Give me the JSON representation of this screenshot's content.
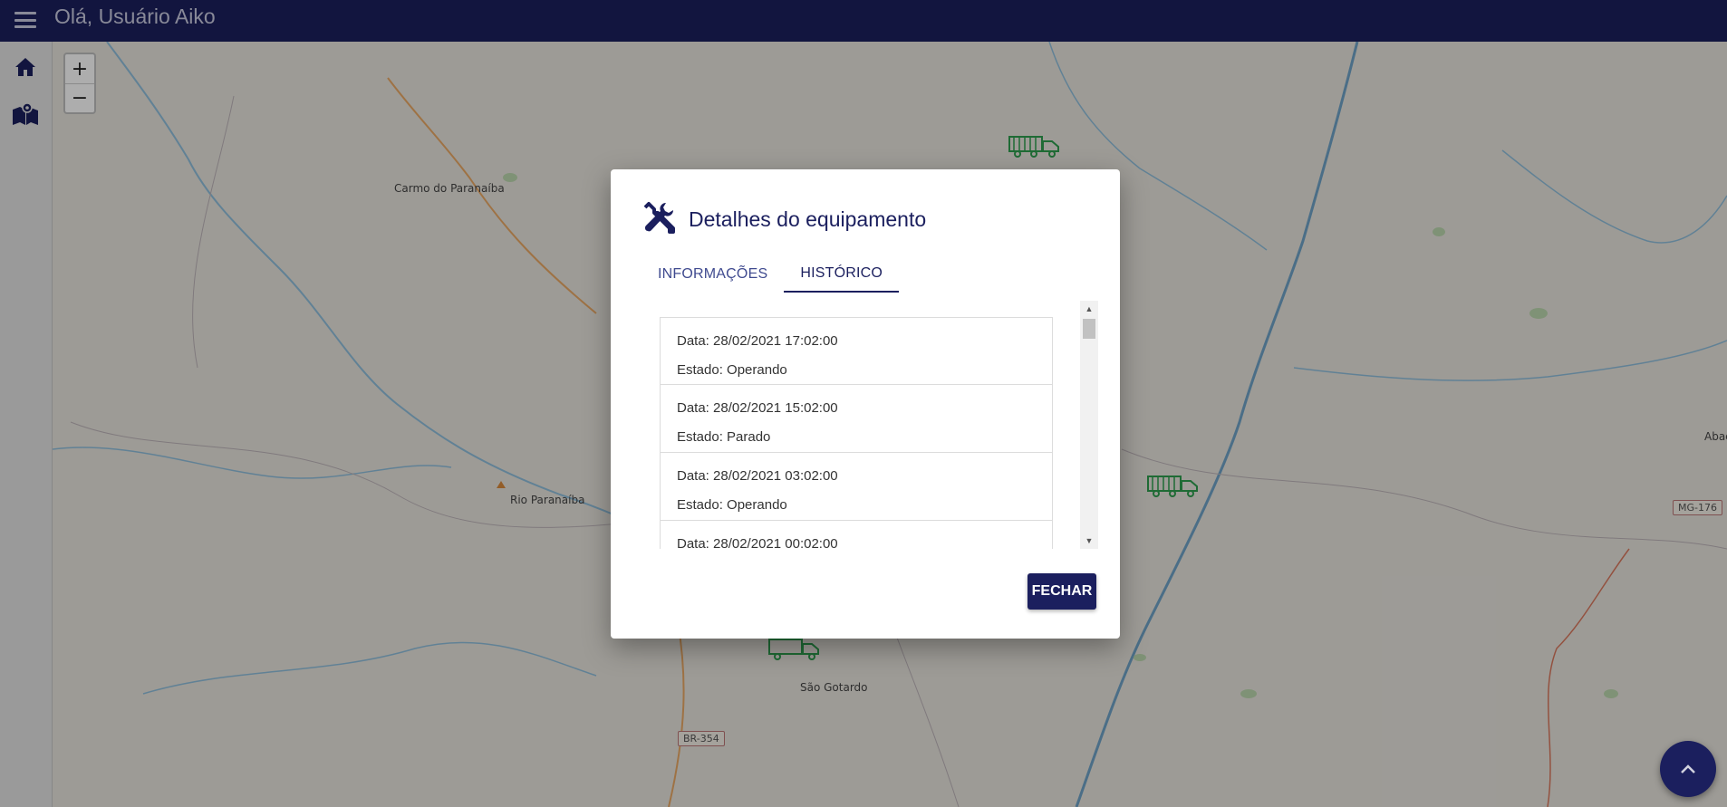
{
  "header": {
    "greeting": "Olá, Usuário Aiko"
  },
  "sidebar": {
    "items": [
      {
        "icon": "home-icon"
      },
      {
        "icon": "map-icon"
      }
    ]
  },
  "map": {
    "zoom_in": "+",
    "zoom_out": "−",
    "places": [
      "Carmo do Paranaíba",
      "Rio Paranaíba",
      "São Gotardo",
      "Abac"
    ],
    "roads": [
      "BR-354",
      "MG-176"
    ]
  },
  "dialog": {
    "title": "Detalhes do equipamento",
    "tabs": [
      {
        "label": "INFORMAÇÕES"
      },
      {
        "label": "HISTÓRICO"
      }
    ],
    "active_tab": "HISTÓRICO",
    "history": [
      {
        "date": "Data: 28/02/2021 17:02:00",
        "state": "Estado: Operando"
      },
      {
        "date": "Data: 28/02/2021 15:02:00",
        "state": "Estado: Parado"
      },
      {
        "date": "Data: 28/02/2021 03:02:00",
        "state": "Estado: Operando"
      },
      {
        "date": "Data: 28/02/2021 00:02:00",
        "state": ""
      }
    ],
    "close_label": "FECHAR"
  },
  "colors": {
    "primary": "#1b1f5e",
    "truck": "#2e9e4f"
  }
}
